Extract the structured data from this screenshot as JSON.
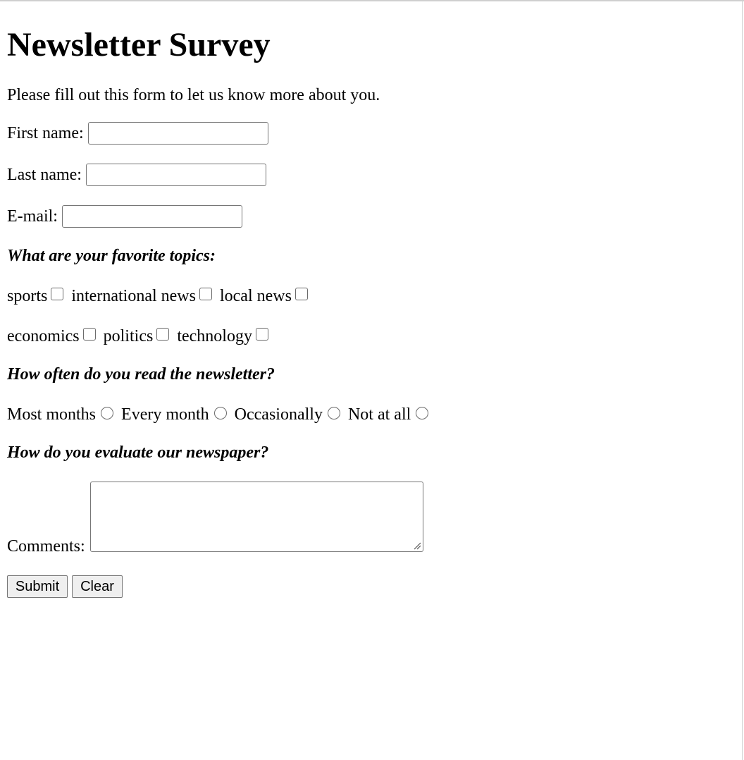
{
  "page": {
    "title": "Newsletter Survey",
    "intro": "Please fill out this form to let us know more about you."
  },
  "fields": {
    "first_name": {
      "label": "First name:",
      "value": ""
    },
    "last_name": {
      "label": "Last name:",
      "value": ""
    },
    "email": {
      "label": "E-mail:",
      "value": ""
    }
  },
  "topics": {
    "question": "What are your favorite topics:",
    "options": [
      {
        "label": "sports",
        "checked": false
      },
      {
        "label": "international news",
        "checked": false
      },
      {
        "label": "local news",
        "checked": false
      },
      {
        "label": "economics",
        "checked": false
      },
      {
        "label": "politics",
        "checked": false
      },
      {
        "label": "technology",
        "checked": false
      }
    ]
  },
  "frequency": {
    "question": "How often do you read the newsletter?",
    "options": [
      {
        "label": "Most months",
        "selected": false
      },
      {
        "label": "Every month",
        "selected": false
      },
      {
        "label": "Occasionally",
        "selected": false
      },
      {
        "label": "Not at all",
        "selected": false
      }
    ]
  },
  "evaluation": {
    "question": "How do you evaluate our newspaper?",
    "comments_label": "Comments:",
    "comments_value": ""
  },
  "buttons": {
    "submit_label": "Submit",
    "clear_label": "Clear"
  },
  "colors": {
    "border": "#767676",
    "button_bg": "#efefef",
    "text": "#000000",
    "background": "#ffffff"
  }
}
